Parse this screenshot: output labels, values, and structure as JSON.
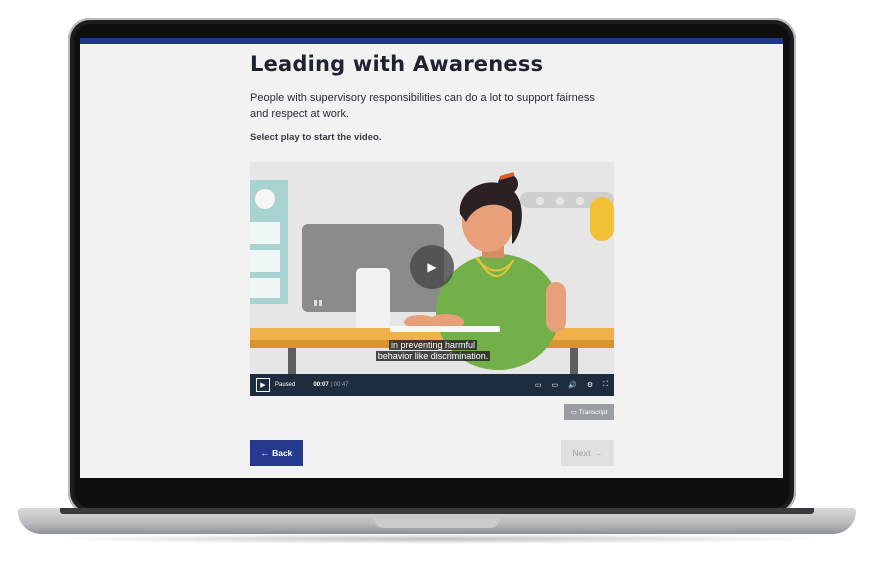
{
  "page": {
    "title": "Leading with Awareness",
    "intro": "People with supervisory responsibilities can do a lot to support fairness and respect at work.",
    "instruction": "Select play to start the video."
  },
  "video": {
    "caption_line1": "in preventing harmful",
    "caption_line2": "behavior like discrimination.",
    "status": "Paused",
    "current_time": "00:07",
    "time_separator": "|",
    "duration": "00:47",
    "big_play_icon": "play-icon",
    "colors": {
      "controls_bg": "#1d2d3f",
      "shirt": "#73b04a",
      "desk": "#f0b14a",
      "monitor": "#8b8b8b",
      "accent_wall": "#a8d3d1"
    }
  },
  "buttons": {
    "transcript": "Transcript",
    "back": "Back",
    "next": "Next"
  },
  "colors": {
    "accent": "#253a8e",
    "topbar": "#1f3a8a"
  }
}
